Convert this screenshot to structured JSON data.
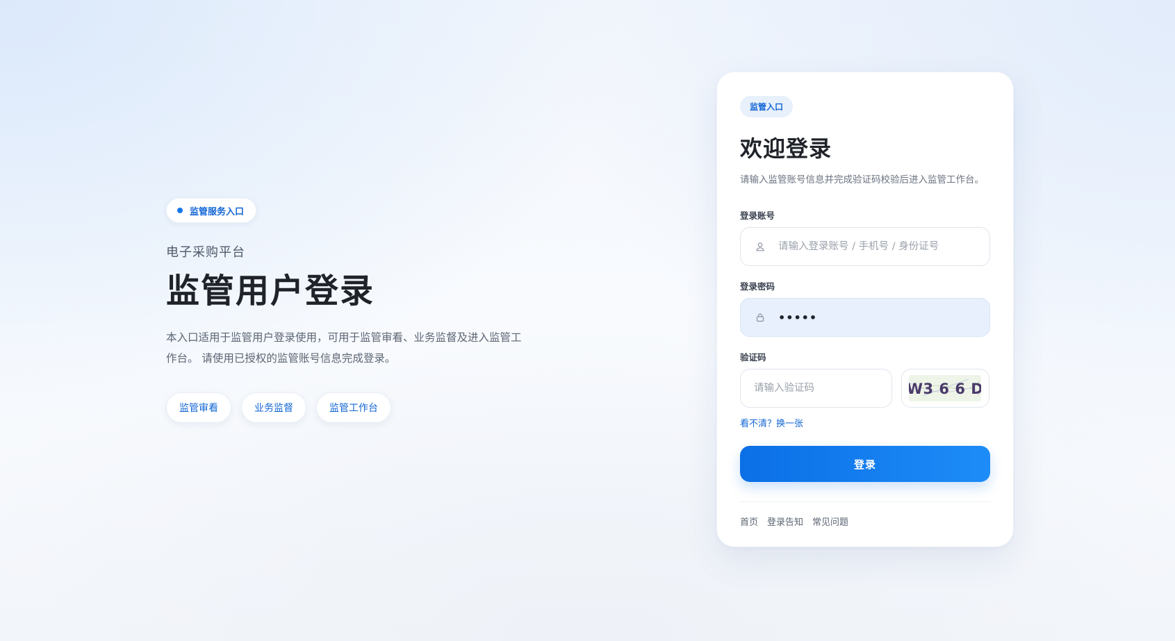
{
  "hero": {
    "badge": "监管服务入口",
    "subtitle": "电子采购平台",
    "title": "监管用户登录",
    "description": "本入口适用于监管用户登录使用，可用于监管审看、业务监督及进入监管工作台。 请使用已授权的监管账号信息完成登录。",
    "chips": [
      "监管审看",
      "业务监督",
      "监管工作台"
    ]
  },
  "login": {
    "badge": "监管入口",
    "title": "欢迎登录",
    "description": "请输入监管账号信息并完成验证码校验后进入监管工作台。",
    "account": {
      "label": "登录账号",
      "placeholder": "请输入登录账号 / 手机号 / 身份证号",
      "value": "",
      "icon": "user-icon"
    },
    "password": {
      "label": "登录密码",
      "value": "•••••",
      "icon": "lock-icon"
    },
    "captcha": {
      "label": "验证码",
      "placeholder": "请输入验证码",
      "value": "",
      "image_text": "W3 6 6 D",
      "refresh_link": "看不清？换一张"
    },
    "submit_label": "登录",
    "footer_links": [
      "首页",
      "登录告知",
      "常见问题"
    ]
  },
  "colors": {
    "accent": "#1366d6",
    "button_start": "#0b6fe6",
    "button_end": "#1d8cf8",
    "filled_input_bg": "#e8f0fd"
  }
}
